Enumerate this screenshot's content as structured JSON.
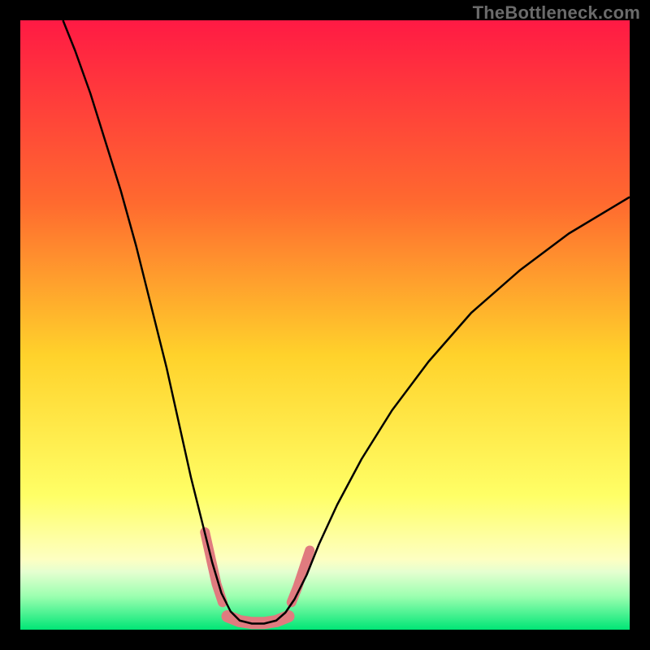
{
  "watermark": "TheBottleneck.com",
  "chart_data": {
    "type": "line",
    "title": "",
    "xlabel": "",
    "ylabel": "",
    "xlim": [
      0,
      100
    ],
    "ylim": [
      0,
      100
    ],
    "grid": false,
    "legend": false,
    "gradient_stops": [
      {
        "offset": 0,
        "color": "#ff1a44"
      },
      {
        "offset": 0.3,
        "color": "#ff6a2f"
      },
      {
        "offset": 0.55,
        "color": "#ffd22b"
      },
      {
        "offset": 0.78,
        "color": "#ffff66"
      },
      {
        "offset": 0.885,
        "color": "#fdffc2"
      },
      {
        "offset": 0.905,
        "color": "#e5ffd0"
      },
      {
        "offset": 0.945,
        "color": "#9cffb0"
      },
      {
        "offset": 1.0,
        "color": "#00e676"
      }
    ],
    "series": [
      {
        "name": "main-curve",
        "style": {
          "stroke": "#000000",
          "width": 2.5
        },
        "points": [
          {
            "x": 7.0,
            "y": 100.0
          },
          {
            "x": 9.0,
            "y": 95.0
          },
          {
            "x": 11.5,
            "y": 88.0
          },
          {
            "x": 14.0,
            "y": 80.0
          },
          {
            "x": 16.5,
            "y": 72.0
          },
          {
            "x": 19.0,
            "y": 63.0
          },
          {
            "x": 21.5,
            "y": 53.0
          },
          {
            "x": 24.0,
            "y": 43.0
          },
          {
            "x": 26.0,
            "y": 34.0
          },
          {
            "x": 28.0,
            "y": 25.0
          },
          {
            "x": 30.0,
            "y": 17.0
          },
          {
            "x": 31.5,
            "y": 11.0
          },
          {
            "x": 33.0,
            "y": 6.0
          },
          {
            "x": 34.5,
            "y": 3.0
          },
          {
            "x": 36.0,
            "y": 1.5
          },
          {
            "x": 38.0,
            "y": 1.0
          },
          {
            "x": 40.0,
            "y": 1.0
          },
          {
            "x": 42.0,
            "y": 1.5
          },
          {
            "x": 43.5,
            "y": 2.8
          },
          {
            "x": 45.0,
            "y": 5.0
          },
          {
            "x": 47.0,
            "y": 9.0
          },
          {
            "x": 49.0,
            "y": 14.0
          },
          {
            "x": 52.0,
            "y": 20.5
          },
          {
            "x": 56.0,
            "y": 28.0
          },
          {
            "x": 61.0,
            "y": 36.0
          },
          {
            "x": 67.0,
            "y": 44.0
          },
          {
            "x": 74.0,
            "y": 52.0
          },
          {
            "x": 82.0,
            "y": 59.0
          },
          {
            "x": 90.0,
            "y": 65.0
          },
          {
            "x": 100.0,
            "y": 71.0
          }
        ]
      },
      {
        "name": "flange-left",
        "style": {
          "stroke": "#e07b7f",
          "width": 12,
          "linecap": "round"
        },
        "points": [
          {
            "x": 30.3,
            "y": 16.0
          },
          {
            "x": 31.3,
            "y": 11.5
          },
          {
            "x": 32.2,
            "y": 7.5
          },
          {
            "x": 33.2,
            "y": 4.5
          }
        ]
      },
      {
        "name": "flange-right",
        "style": {
          "stroke": "#e07b7f",
          "width": 12,
          "linecap": "round"
        },
        "points": [
          {
            "x": 44.5,
            "y": 4.5
          },
          {
            "x": 45.5,
            "y": 7.0
          },
          {
            "x": 46.5,
            "y": 10.0
          },
          {
            "x": 47.5,
            "y": 13.0
          }
        ]
      },
      {
        "name": "bottom-lobe",
        "style": {
          "stroke": "#e07b7f",
          "width": 15,
          "linecap": "round"
        },
        "points": [
          {
            "x": 34.0,
            "y": 2.2
          },
          {
            "x": 36.0,
            "y": 1.4
          },
          {
            "x": 38.0,
            "y": 1.1
          },
          {
            "x": 40.0,
            "y": 1.1
          },
          {
            "x": 42.0,
            "y": 1.4
          },
          {
            "x": 44.0,
            "y": 2.2
          }
        ]
      }
    ]
  }
}
